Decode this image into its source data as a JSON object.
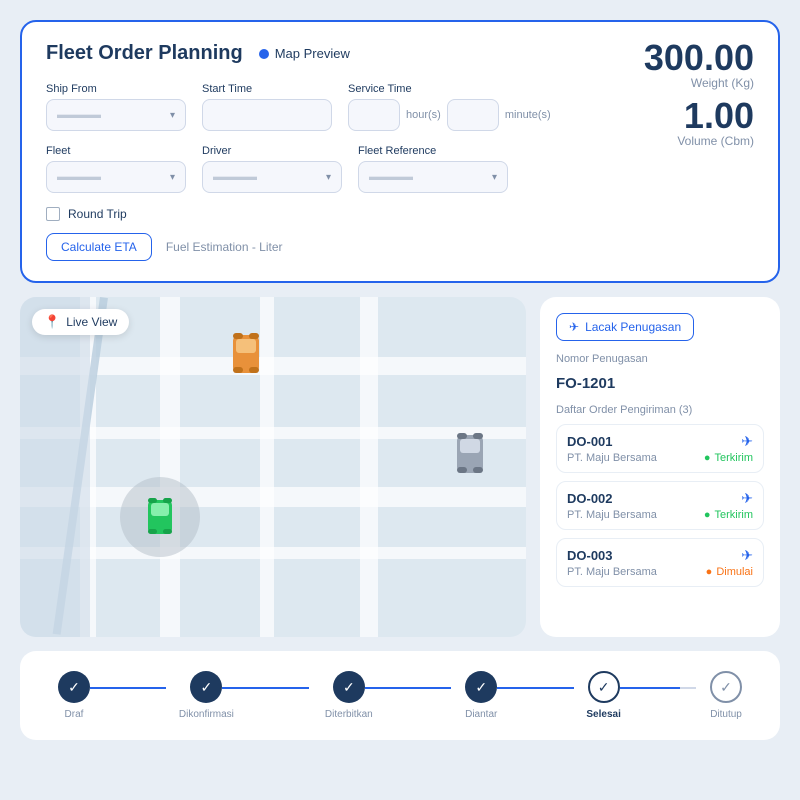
{
  "app": {
    "title": "Fleet Order Planning",
    "map_preview_label": "Map Preview"
  },
  "form": {
    "ship_from_label": "Ship From",
    "start_time_label": "Start Time",
    "service_time_label": "Service Time",
    "fleet_label": "Fleet",
    "driver_label": "Driver",
    "fleet_ref_label": "Fleet Reference",
    "hours_label": "hour(s)",
    "minutes_label": "minute(s)",
    "round_trip_label": "Round Trip",
    "calculate_eta_label": "Calculate ETA",
    "fuel_estimation_label": "Fuel Estimation - Liter"
  },
  "stats": {
    "weight_value": "300.00",
    "weight_label": "Weight (Kg)",
    "volume_value": "1.00",
    "volume_label": "Volume (Cbm)"
  },
  "map": {
    "live_view_label": "Live View"
  },
  "panel": {
    "track_label": "Lacak Penugasan",
    "nomor_label": "Nomor Penugasan",
    "nomor_value": "FO-1201",
    "order_list_label": "Daftar Order Pengiriman (3)",
    "orders": [
      {
        "id": "DO-001",
        "company": "PT. Maju Bersama",
        "status": "Terkirim",
        "status_type": "green"
      },
      {
        "id": "DO-002",
        "company": "PT. Maju Bersama",
        "status": "Terkirim",
        "status_type": "green"
      },
      {
        "id": "DO-003",
        "company": "PT. Maju Bersama",
        "status": "Dimulai",
        "status_type": "orange"
      }
    ]
  },
  "progress": {
    "steps": [
      {
        "label": "Draf",
        "state": "filled"
      },
      {
        "label": "Dikonfirmasi",
        "state": "filled"
      },
      {
        "label": "Diterbitkan",
        "state": "filled"
      },
      {
        "label": "Diantar",
        "state": "filled"
      },
      {
        "label": "Selesai",
        "state": "active"
      },
      {
        "label": "Ditutup",
        "state": "outline"
      }
    ]
  }
}
